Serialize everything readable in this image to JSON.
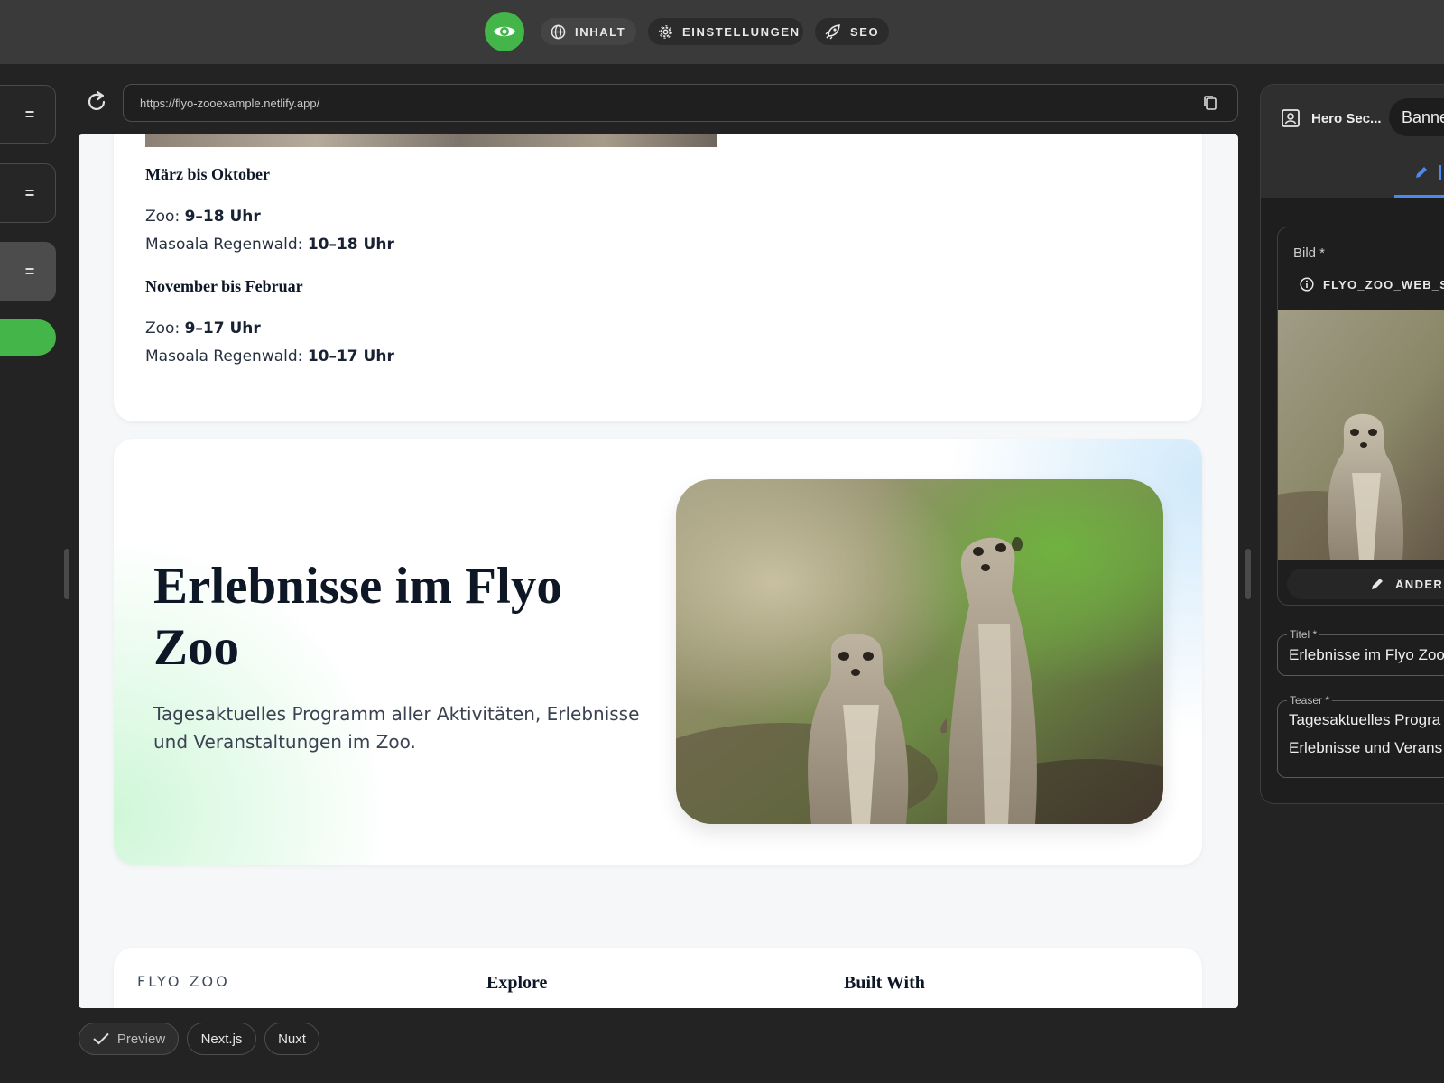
{
  "toolbar": {
    "preview_icon": "eye-icon",
    "tabs": [
      {
        "label": "INHALT",
        "icon": "globe-icon"
      },
      {
        "label": "EINSTELLUNGEN",
        "icon": "gear-icon"
      },
      {
        "label": "SEO",
        "icon": "rocket-icon"
      }
    ]
  },
  "sidebar": {
    "items": [
      {
        "label": "="
      },
      {
        "label": "="
      },
      {
        "label": "="
      }
    ]
  },
  "urlbar": {
    "url": "https://flyo-zooexample.netlify.app/"
  },
  "preview": {
    "opening_hours": [
      {
        "season": "März bis Oktober",
        "lines": [
          {
            "label": "Zoo: ",
            "value": "9–18 Uhr"
          },
          {
            "label": "Masoala Regenwald: ",
            "value": "10–18 Uhr"
          }
        ]
      },
      {
        "season": "November bis Februar",
        "lines": [
          {
            "label": "Zoo: ",
            "value": "9–17 Uhr"
          },
          {
            "label": "Masoala Regenwald: ",
            "value": "10–17 Uhr"
          }
        ]
      }
    ],
    "hero": {
      "title": "Erlebnisse im Flyo Zoo",
      "teaser": "Tagesaktuelles Programm aller Aktivitäten, Erlebnisse und Veranstaltungen im Zoo."
    },
    "footer": {
      "brand": "FLYO ZOO",
      "col1": "Explore",
      "col2": "Built With"
    }
  },
  "frameworks": [
    {
      "label": "Preview",
      "selected": true
    },
    {
      "label": "Next.js",
      "selected": false
    },
    {
      "label": "Nuxt",
      "selected": false
    }
  ],
  "editor": {
    "block_name": "Hero Sec...",
    "block_type": "Banne",
    "image_field": {
      "label": "Bild *",
      "filename": "FLYO_ZOO_WEB_ST",
      "change_label": "ÄNDERN"
    },
    "title_field": {
      "label": "Titel *",
      "value": "Erlebnisse im Flyo Zoo"
    },
    "teaser_field": {
      "label": "Teaser *",
      "line1": "Tagesaktuelles Progra",
      "line2": "Erlebnisse und Verans"
    }
  },
  "colors": {
    "accent_green": "#43b549",
    "accent_blue": "#4a88f2"
  }
}
